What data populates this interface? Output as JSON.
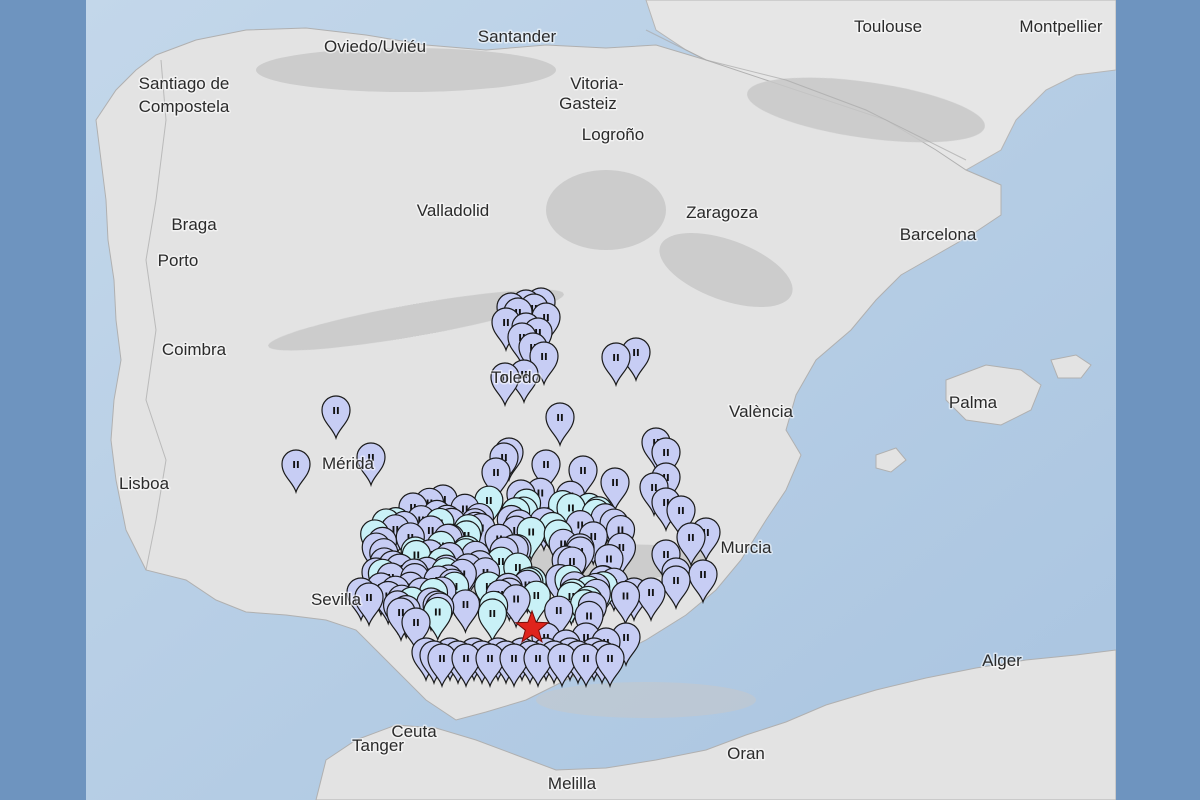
{
  "map": {
    "colors": {
      "frame": "#6e94bf",
      "sea": "#b9d0e6",
      "sea_deep": "#a3c0de",
      "land": "#e4e4e4",
      "mountain": "#c7c7c7",
      "pin_light": "#c7cdf4",
      "pin_cyan": "#c9f1f7",
      "pin_stroke": "#1a1a1a",
      "epicenter": "#e0241c"
    },
    "cities": [
      {
        "name": "Toulouse"
      },
      {
        "name": "Montpellier"
      },
      {
        "name": "Santander"
      },
      {
        "name": "Oviedo/Uviéu"
      },
      {
        "name": "Santiago de"
      },
      {
        "name": "Compostela"
      },
      {
        "name": "Vitoria-"
      },
      {
        "name": "Gasteiz"
      },
      {
        "name": "Logroño"
      },
      {
        "name": "Braga"
      },
      {
        "name": "Porto"
      },
      {
        "name": "Valladolid"
      },
      {
        "name": "Zaragoza"
      },
      {
        "name": "Barcelona"
      },
      {
        "name": "Coimbra"
      },
      {
        "name": "Toledo"
      },
      {
        "name": "València"
      },
      {
        "name": "Palma"
      },
      {
        "name": "Mérida"
      },
      {
        "name": "Lisboa"
      },
      {
        "name": "Murcia"
      },
      {
        "name": "Sevilla"
      },
      {
        "name": "Alger"
      },
      {
        "name": "Ceuta"
      },
      {
        "name": "Tanger"
      },
      {
        "name": "Oran"
      },
      {
        "name": "Melilla"
      }
    ],
    "intensity_label": "II",
    "epicenter_icon": "star-icon"
  }
}
